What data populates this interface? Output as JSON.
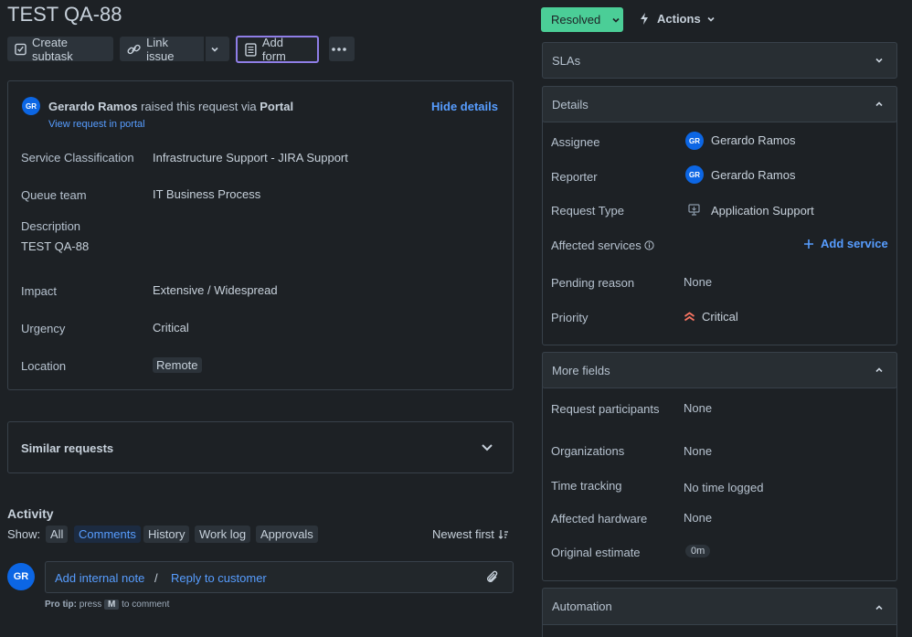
{
  "issue": {
    "title": "TEST QA-88"
  },
  "toolbar": {
    "create_subtask": "Create subtask",
    "link_issue": "Link issue",
    "add_form": "Add form"
  },
  "status": {
    "label": "Resolved",
    "actions": "Actions"
  },
  "request": {
    "reporter_name": "Gerardo Ramos",
    "raised_text": "raised this request via",
    "channel": "Portal",
    "view_portal": "View request in portal",
    "hide_details": "Hide details",
    "fields": [
      {
        "label": "Service Classification",
        "value": "Infrastructure Support - JIRA Support"
      },
      {
        "label": "Queue team",
        "value": "IT Business Process"
      },
      {
        "label": "Description",
        "value": "TEST QA-88"
      },
      {
        "label": "Impact",
        "value": "Extensive / Widespread"
      },
      {
        "label": "Urgency",
        "value": "Critical"
      },
      {
        "label": "Location",
        "value": "Remote"
      }
    ]
  },
  "similar": {
    "label": "Similar requests"
  },
  "activity": {
    "heading": "Activity",
    "show_label": "Show:",
    "filters": [
      "All",
      "Comments",
      "History",
      "Work log",
      "Approvals"
    ],
    "sort": "Newest first",
    "add_internal_note": "Add internal note",
    "separator": "/",
    "reply_to_customer": "Reply to customer",
    "pro_tip_bold": "Pro tip:",
    "pro_tip_press": "press",
    "pro_tip_key": "M",
    "pro_tip_end": "to comment",
    "avatar_initials": "GR"
  },
  "sidebar": {
    "slas": "SLAs",
    "details": "Details",
    "details_rows": [
      {
        "label": "Assignee",
        "value": "Gerardo Ramos"
      },
      {
        "label": "Reporter",
        "value": "Gerardo Ramos"
      },
      {
        "label": "Request Type",
        "value": "Application Support"
      },
      {
        "label": "Affected services",
        "value": "Add service"
      },
      {
        "label": "Pending reason",
        "value": "None"
      },
      {
        "label": "Priority",
        "value": "Critical"
      }
    ],
    "more_fields": "More fields",
    "more_rows": [
      {
        "label": "Request participants",
        "value": "None"
      },
      {
        "label": "Organizations",
        "value": "None"
      },
      {
        "label": "Time tracking",
        "value": "No time logged"
      },
      {
        "label": "Affected hardware",
        "value": "None"
      },
      {
        "label": "Original estimate",
        "value": "0m"
      }
    ],
    "automation": "Automation",
    "avatar_initials": "GR"
  },
  "colors": {
    "accent": "#579dff",
    "resolved": "#4bce97",
    "priority": "#f87462",
    "form_border": "#8f7ee7"
  }
}
